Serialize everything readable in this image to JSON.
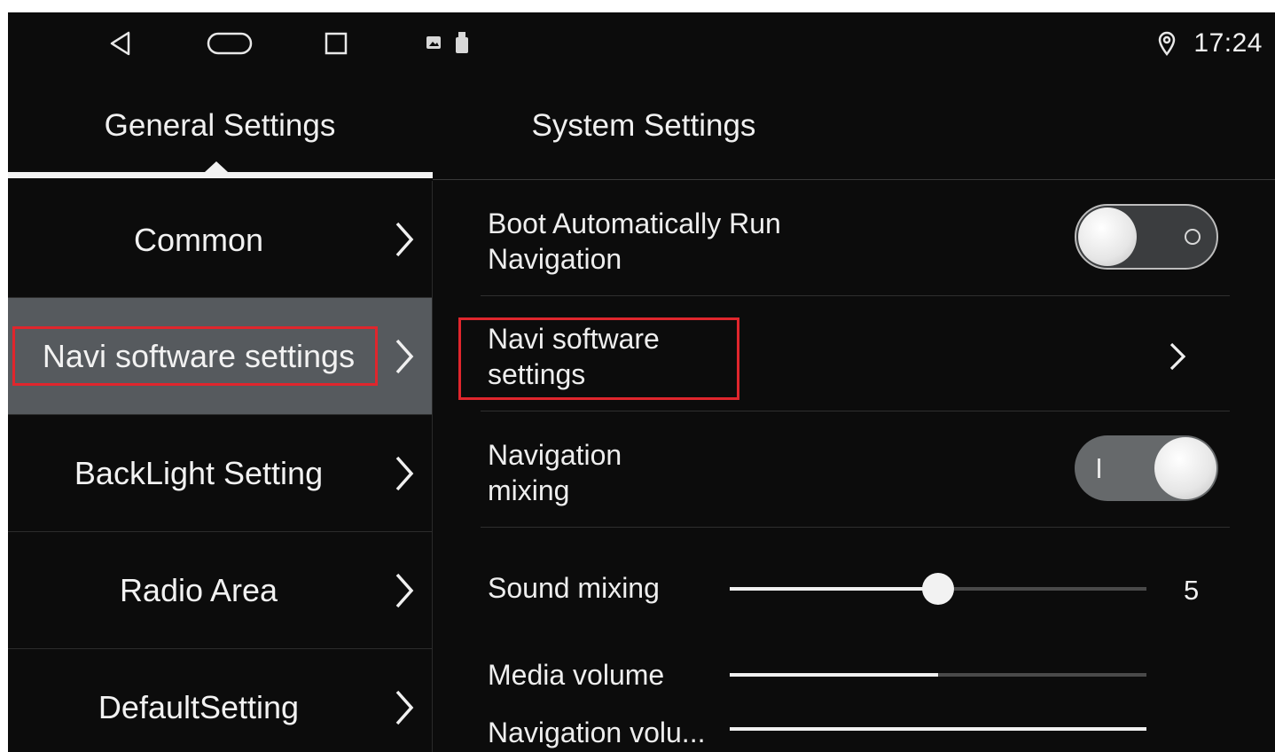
{
  "status_bar": {
    "time": "17:24",
    "icons": [
      "back-icon",
      "home-icon",
      "recent-apps-icon",
      "image-notification-icon",
      "usb-icon",
      "location-icon"
    ]
  },
  "tabs": [
    {
      "label": "General Settings",
      "selected": true
    },
    {
      "label": "System Settings",
      "selected": false
    }
  ],
  "left_menu": {
    "items": [
      {
        "label": "Common"
      },
      {
        "label": "Navi software settings",
        "selected": true
      },
      {
        "label": "BackLight Setting"
      },
      {
        "label": "Radio Area"
      },
      {
        "label": "DefaultSetting"
      }
    ]
  },
  "settings": {
    "boot_nav": {
      "line1": "Boot Automatically Run",
      "line2": "Navigation",
      "on": false
    },
    "navi_software": {
      "line1": "Navi software",
      "line2": "settings"
    },
    "nav_mixing": {
      "line1": "Navigation",
      "line2": "mixing",
      "on": true
    },
    "sound_mixing": {
      "label": "Sound mixing",
      "value": "5",
      "level": 0.5
    },
    "media_volume": {
      "label": "Media volume",
      "level": 0.5
    },
    "navigation_volume": {
      "label": "Navigation volu...",
      "level": 1.0
    }
  },
  "colors": {
    "highlight_box": "#e0262d",
    "selected_row": "#565a5e",
    "background": "#0c0c0c"
  }
}
